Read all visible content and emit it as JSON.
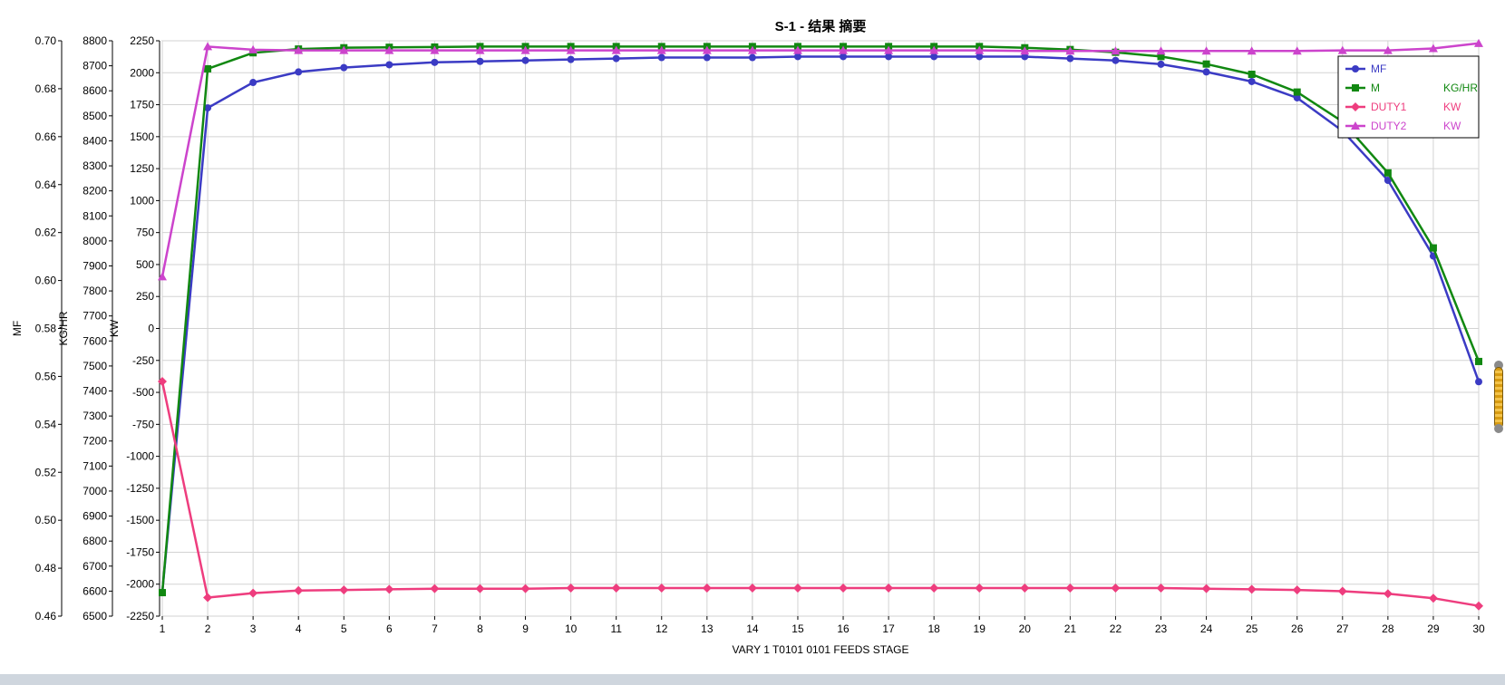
{
  "chart_data": {
    "type": "line",
    "title": "S-1 - 结果 摘要",
    "xlabel": "VARY   1 T0101     0101      FEEDS     STAGE",
    "x": [
      1,
      2,
      3,
      4,
      5,
      6,
      7,
      8,
      9,
      10,
      11,
      12,
      13,
      14,
      15,
      16,
      17,
      18,
      19,
      20,
      21,
      22,
      23,
      24,
      25,
      26,
      27,
      28,
      29,
      30
    ],
    "xlim": [
      1,
      30
    ],
    "grid": true,
    "legend_position": "top-right",
    "axes": [
      {
        "id": "mf",
        "label": "MF",
        "ylim": [
          0.46,
          0.7
        ],
        "ticks": [
          "0.46",
          "0.48",
          "0.50",
          "0.52",
          "0.54",
          "0.56",
          "0.58",
          "0.60",
          "0.62",
          "0.64",
          "0.66",
          "0.68",
          "0.70"
        ]
      },
      {
        "id": "kghr",
        "label": "KG/HR",
        "ylim": [
          6500,
          8800
        ],
        "ticks": [
          "6500",
          "6600",
          "6700",
          "6800",
          "6900",
          "7000",
          "7100",
          "7200",
          "7300",
          "7400",
          "7500",
          "7600",
          "7700",
          "7800",
          "7900",
          "8000",
          "8100",
          "8200",
          "8300",
          "8400",
          "8500",
          "8600",
          "8700",
          "8800"
        ]
      },
      {
        "id": "kw",
        "label": "KW",
        "ylim": [
          -2250,
          2250
        ],
        "ticks": [
          "-2250",
          "-2000",
          "-1750",
          "-1500",
          "-1250",
          "-1000",
          "-750",
          "-500",
          "-250",
          "0",
          "250",
          "500",
          "750",
          "1000",
          "1250",
          "1500",
          "1750",
          "2000",
          "2250"
        ]
      }
    ],
    "series": [
      {
        "name": "MF",
        "unit": "",
        "axis": "mf",
        "color": "#3b3bc4",
        "marker": "circle",
        "values": [
          0.4699,
          0.672,
          0.6826,
          0.687,
          0.6888,
          0.69,
          0.691,
          0.6914,
          0.6918,
          0.6922,
          0.6926,
          0.693,
          0.693,
          0.693,
          0.6934,
          0.6934,
          0.6934,
          0.6934,
          0.6934,
          0.6934,
          0.6926,
          0.6918,
          0.6902,
          0.687,
          0.683,
          0.6762,
          0.6624,
          0.6418,
          0.6102,
          0.5578
        ]
      },
      {
        "name": "M",
        "unit": "KG/HR",
        "axis": "kghr",
        "color": "#118811",
        "marker": "square",
        "values": [
          6594,
          8688,
          8752,
          8767,
          8772,
          8774,
          8775,
          8777,
          8777,
          8777,
          8777,
          8777,
          8777,
          8777,
          8777,
          8777,
          8777,
          8777,
          8777,
          8772,
          8765,
          8754,
          8737,
          8707,
          8666,
          8595,
          8477,
          8272,
          7972,
          7518
        ]
      },
      {
        "name": "DUTY1",
        "unit": "KW",
        "axis": "kw",
        "color": "#ee3d7e",
        "marker": "diamond",
        "values": [
          -415,
          -2105,
          -2070,
          -2050,
          -2045,
          -2040,
          -2035,
          -2035,
          -2035,
          -2030,
          -2030,
          -2030,
          -2030,
          -2030,
          -2030,
          -2030,
          -2030,
          -2030,
          -2030,
          -2030,
          -2030,
          -2030,
          -2030,
          -2035,
          -2040,
          -2045,
          -2055,
          -2075,
          -2110,
          -2170
        ]
      },
      {
        "name": "DUTY2",
        "unit": "KW",
        "axis": "kw",
        "color": "#cc44cc",
        "marker": "triangle",
        "values": [
          405,
          2205,
          2180,
          2175,
          2175,
          2175,
          2175,
          2175,
          2175,
          2175,
          2175,
          2175,
          2175,
          2175,
          2175,
          2175,
          2175,
          2175,
          2175,
          2170,
          2170,
          2170,
          2170,
          2170,
          2170,
          2170,
          2175,
          2175,
          2190,
          2230
        ]
      }
    ]
  }
}
